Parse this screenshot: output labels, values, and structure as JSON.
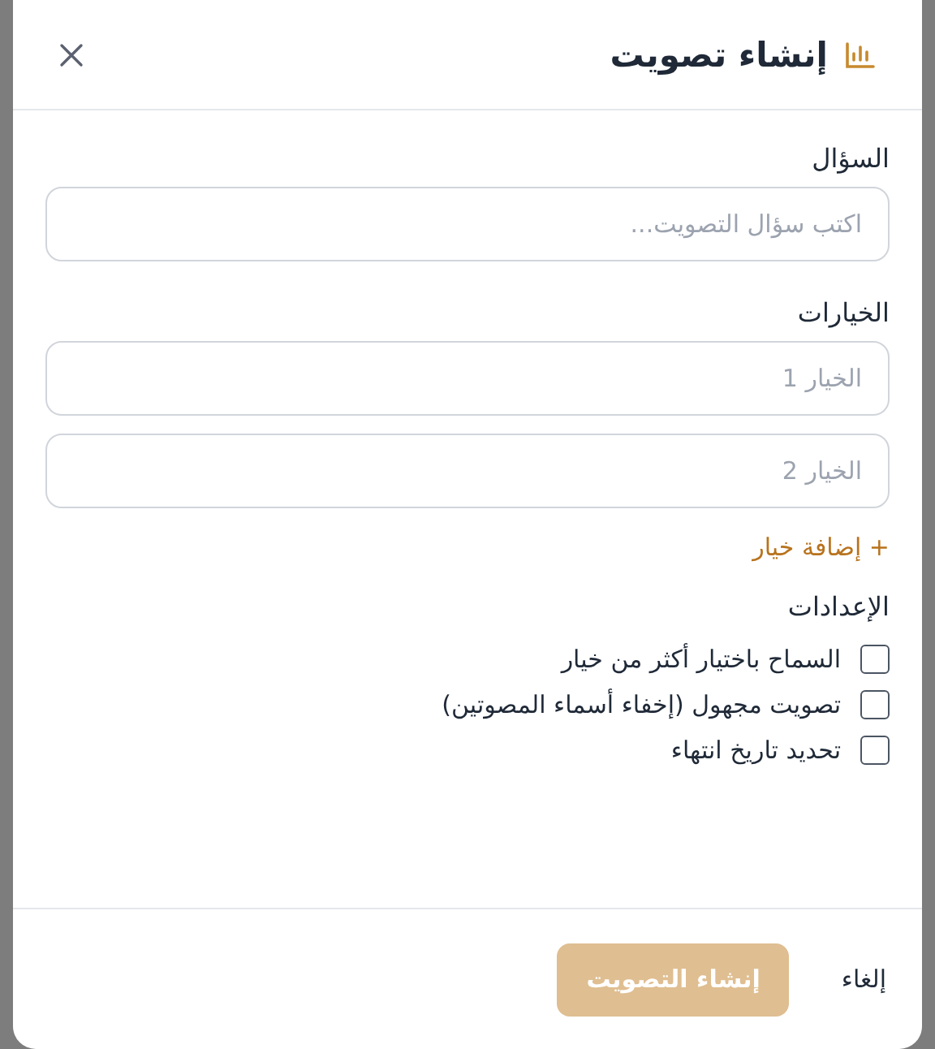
{
  "dialog": {
    "title": "إنشاء تصويت"
  },
  "question": {
    "label": "السؤال",
    "placeholder": "اكتب سؤال التصويت..."
  },
  "options": {
    "label": "الخيارات",
    "items": [
      {
        "placeholder": "الخيار 1"
      },
      {
        "placeholder": "الخيار 2"
      }
    ],
    "add_label": "إضافة خيار",
    "add_icon": "+"
  },
  "settings": {
    "label": "الإعدادات",
    "items": [
      {
        "label": "السماح باختيار أكثر من خيار",
        "checked": false
      },
      {
        "label": "تصويت مجهول (إخفاء أسماء المصوتين)",
        "checked": false
      },
      {
        "label": "تحديد تاريخ انتهاء",
        "checked": false
      }
    ]
  },
  "footer": {
    "cancel": "إلغاء",
    "submit": {
      "label": "إنشاء التصويت",
      "disabled": true
    }
  }
}
